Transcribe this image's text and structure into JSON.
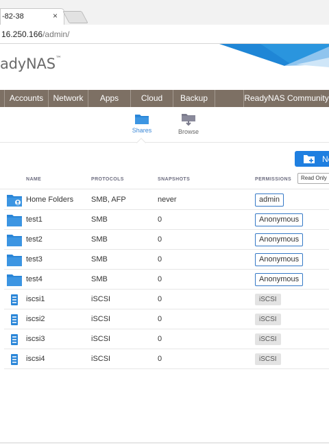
{
  "browser": {
    "tab_title": "-82-38",
    "tab_close": "×",
    "url_host": "16.250.166",
    "url_path": "/admin/"
  },
  "header": {
    "brand": "adyNAS",
    "trademark": "™"
  },
  "nav": {
    "items": [
      {
        "label": ""
      },
      {
        "label": "Accounts"
      },
      {
        "label": "Network"
      },
      {
        "label": "Apps"
      },
      {
        "label": "Cloud"
      },
      {
        "label": "Backup"
      },
      {
        "label": ""
      },
      {
        "label": "ReadyNAS Community"
      }
    ]
  },
  "subnav": {
    "shares": "Shares",
    "browse": "Browse",
    "active_color": "#3a87d6"
  },
  "toolbar": {
    "new_label": "Ne"
  },
  "table": {
    "headers": {
      "name": "NAME",
      "protocols": "PROTOCOLS",
      "snapshots": "SNAPSHOTS",
      "permissions": "PERMISSIONS"
    },
    "permission_filter": "Read Only",
    "rows": [
      {
        "icon": "home-folder-icon",
        "name": "Home Folders",
        "protocols": "SMB, AFP",
        "snapshots": "never",
        "permission": "admin",
        "perm_style": "outlined"
      },
      {
        "icon": "folder-icon",
        "name": "test1",
        "protocols": "SMB",
        "snapshots": "0",
        "permission": "Anonymous",
        "perm_style": "outlined"
      },
      {
        "icon": "folder-icon",
        "name": "test2",
        "protocols": "SMB",
        "snapshots": "0",
        "permission": "Anonymous",
        "perm_style": "outlined"
      },
      {
        "icon": "folder-icon",
        "name": "test3",
        "protocols": "SMB",
        "snapshots": "0",
        "permission": "Anonymous",
        "perm_style": "outlined"
      },
      {
        "icon": "folder-icon",
        "name": "test4",
        "protocols": "SMB",
        "snapshots": "0",
        "permission": "Anonymous",
        "perm_style": "outlined"
      },
      {
        "icon": "lun-icon",
        "name": "iscsi1",
        "protocols": "iSCSI",
        "snapshots": "0",
        "permission": "iSCSI",
        "perm_style": "gray"
      },
      {
        "icon": "lun-icon",
        "name": "iscsi2",
        "protocols": "iSCSI",
        "snapshots": "0",
        "permission": "iSCSI",
        "perm_style": "gray"
      },
      {
        "icon": "lun-icon",
        "name": "iscsi3",
        "protocols": "iSCSI",
        "snapshots": "0",
        "permission": "iSCSI",
        "perm_style": "gray"
      },
      {
        "icon": "lun-icon",
        "name": "iscsi4",
        "protocols": "iSCSI",
        "snapshots": "0",
        "permission": "iSCSI",
        "perm_style": "gray"
      }
    ]
  },
  "colors": {
    "nav_bg": "#7d7064",
    "accent_blue": "#1f7fe0",
    "folder_blue": "#2a86d8",
    "badge_border": "#3478c6"
  }
}
